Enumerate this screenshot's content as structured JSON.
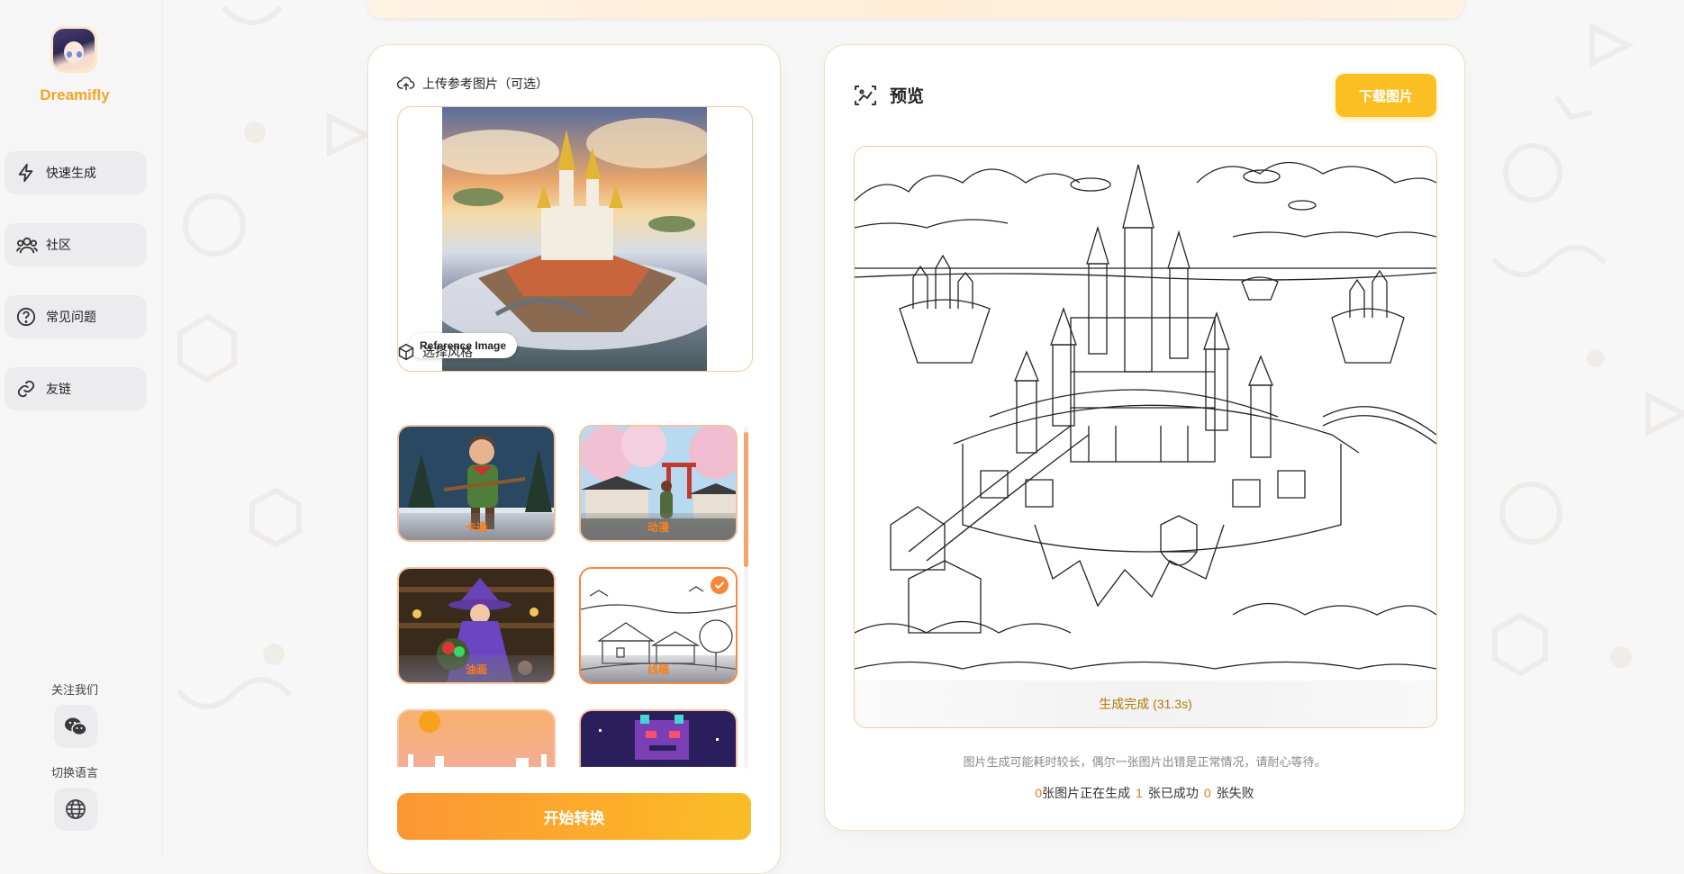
{
  "sidebar": {
    "brand": "Dreamifly",
    "items": [
      {
        "label": "快速生成",
        "icon": "lightning-icon"
      },
      {
        "label": "社区",
        "icon": "users-icon"
      },
      {
        "label": "常见问题",
        "icon": "help-circle-icon"
      },
      {
        "label": "友链",
        "icon": "link-icon"
      }
    ],
    "follow_label": "关注我们",
    "language_label": "切换语言"
  },
  "upload": {
    "title": "上传参考图片（可选）",
    "chip": "Reference Image"
  },
  "styles": {
    "title": "选择风格",
    "items": [
      {
        "label": "卡通",
        "selected": false
      },
      {
        "label": "动漫",
        "selected": false
      },
      {
        "label": "油画",
        "selected": false
      },
      {
        "label": "线稿",
        "selected": true
      },
      {
        "label": "",
        "selected": false
      },
      {
        "label": "",
        "selected": false
      }
    ]
  },
  "convert_button": "开始转换",
  "preview": {
    "title": "预览",
    "download_button": "下载图片",
    "status": "生成完成 (31.3s)",
    "hint": "图片生成可能耗时较长，偶尔一张图片出错是正常情况，请耐心等待。",
    "counts": {
      "generating": "0",
      "generating_label": "张图片正在生成",
      "success": "1",
      "success_label": "张已成功",
      "failed": "0",
      "failed_label": "张失败"
    }
  },
  "colors": {
    "accent": "#f5a524",
    "button_start": "#fd9633",
    "button_end": "#fbbd26",
    "selected_border": "#f7873a"
  }
}
